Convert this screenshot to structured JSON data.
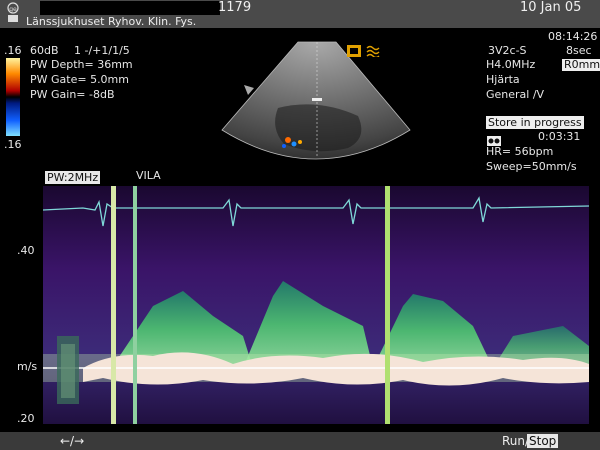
{
  "header": {
    "patient_id": "1179",
    "date": "10 Jan 05",
    "hospital": "Länssjukhuset Ryhov. Klin. Fys."
  },
  "left_panel": {
    "scale_top": ".16",
    "scale_bottom": ".16",
    "dynamic_range": "60dB",
    "settings": "1 -/+1/1/5",
    "pw_depth": "PW Depth= 36mm",
    "pw_gate": "PW Gate= 5.0mm",
    "pw_gain": "PW Gain= -8dB"
  },
  "right_panel": {
    "time": "08:14:26",
    "probe": "3V2c-S",
    "duration": "8sec",
    "freq": "H4.0MHz",
    "r0_button": "R0mm",
    "app": "Hjärta",
    "preset": "General /V"
  },
  "store": {
    "label": "Store in progress",
    "elapsed": "0:03:31",
    "hr": "HR= 56bpm",
    "sweep": "Sweep=50mm/s"
  },
  "doppler": {
    "mode_tag": "PW:2MHz",
    "label": "VILA",
    "axis_top": ".40",
    "axis_unit": "m/s",
    "axis_bottom": ".20"
  },
  "footer": {
    "nav": "←/→",
    "run": "Run/",
    "stop": "Stop"
  }
}
